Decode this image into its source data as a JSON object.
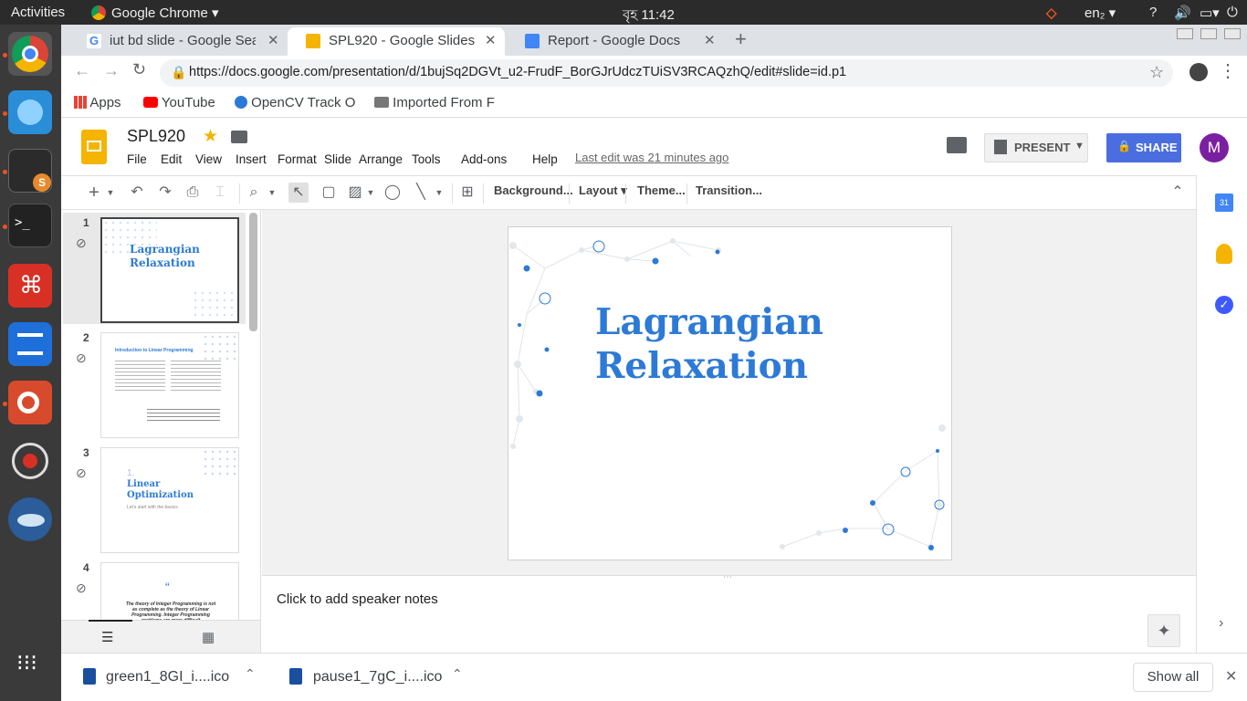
{
  "system": {
    "activities": "Activities",
    "app_name": "Google Chrome",
    "clock": "বৃহ 11:42",
    "keyboard": "en₂"
  },
  "browser": {
    "tabs": [
      {
        "title": "iut bd slide - Google Searc",
        "icon": "google-icon"
      },
      {
        "title": "SPL920 - Google Slides",
        "icon": "slides-icon"
      },
      {
        "title": "Report - Google Docs",
        "icon": "docs-icon"
      }
    ],
    "url": "https://docs.google.com/presentation/d/1bujSq2DGVt_u2-FrudF_BorGJrUdczTUiSV3RCAQzhQ/edit#slide=id.p1",
    "bookmarks": [
      "Apps",
      "YouTube",
      "OpenCV Track O",
      "Imported From F"
    ]
  },
  "doc": {
    "title": "SPL920",
    "menu": [
      "File",
      "Edit",
      "View",
      "Insert",
      "Format",
      "Slide",
      "Arrange",
      "Tools",
      "Add-ons",
      "Help"
    ],
    "last_edit": "Last edit was 21 minutes ago",
    "present_label": "PRESENT",
    "share_label": "SHARE",
    "avatar_letter": "M"
  },
  "toolbar": {
    "background": "Background...",
    "layout": "Layout",
    "theme": "Theme...",
    "transition": "Transition..."
  },
  "slides": [
    {
      "num": "1",
      "title": "Lagrangian Relaxation"
    },
    {
      "num": "2",
      "title": "Introduction to Linear Programming"
    },
    {
      "num": "3",
      "sub_num": "1.",
      "title": "Linear Optimization",
      "subtitle": "Let's start with the basics"
    },
    {
      "num": "4",
      "quote_mark": "“",
      "text": "The theory of Integer Programming is not as complete as the theory of Linear Programming. Integer Programming problems are more difficult"
    }
  ],
  "main_slide": {
    "title_line1": "Lagrangian",
    "title_line2": "Relaxation"
  },
  "notes_placeholder": "Click to add speaker notes",
  "downloads": [
    {
      "name": "green1_8GI_i....ico"
    },
    {
      "name": "pause1_7gC_i....ico"
    }
  ],
  "show_all": "Show all",
  "colors": {
    "accent_blue": "#2d7ad6",
    "share_blue": "#4a6ee0",
    "avatar_purple": "#7b1fa2",
    "slides_yellow": "#f4b400"
  }
}
